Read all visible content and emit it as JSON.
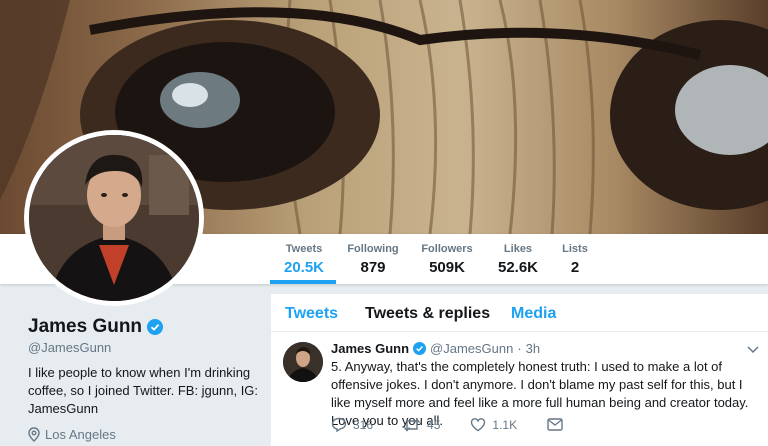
{
  "profile": {
    "name": "James Gunn",
    "handle": "@JamesGunn",
    "bio": "I like people to know when I'm drinking coffee, so I joined Twitter. FB: jgunn, IG: JamesGunn",
    "location": "Los Angeles"
  },
  "stats": [
    {
      "label": "Tweets",
      "value": "20.5K"
    },
    {
      "label": "Following",
      "value": "879"
    },
    {
      "label": "Followers",
      "value": "509K"
    },
    {
      "label": "Likes",
      "value": "52.6K"
    },
    {
      "label": "Lists",
      "value": "2"
    }
  ],
  "tabs": [
    {
      "label": "Tweets"
    },
    {
      "label": "Tweets & replies"
    },
    {
      "label": "Media"
    }
  ],
  "tweet": {
    "name": "James Gunn",
    "handle": "@JamesGunn",
    "separator": "·",
    "time": "3h",
    "text": "5. Anyway, that's the completely honest truth: I used to make a lot of offensive jokes. I don't anymore. I don't blame my past self for this, but I like myself more and feel like a more full human being and creator today.  Love you to you all.",
    "replies": "316",
    "retweets": "45",
    "likes": "1.1K"
  },
  "colors": {
    "accent": "#1da1f2",
    "text": "#14171a",
    "muted": "#657786"
  },
  "icons": [
    "verified-badge-icon",
    "location-pin-icon",
    "caret-down-icon",
    "reply-icon",
    "retweet-icon",
    "like-heart-icon",
    "direct-message-icon"
  ]
}
